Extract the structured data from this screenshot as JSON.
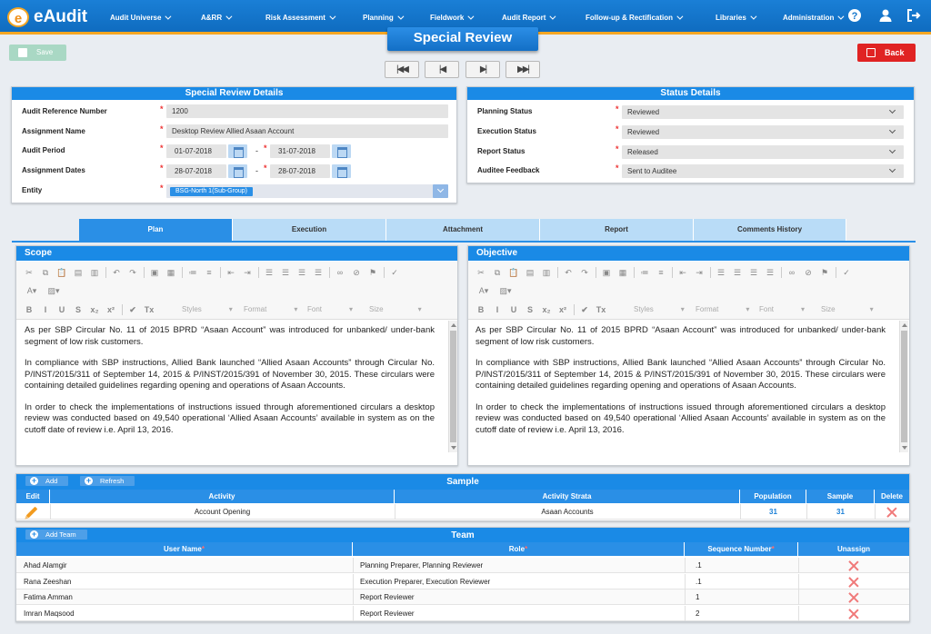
{
  "app": {
    "name": "eAudit",
    "logo_letter": "e"
  },
  "nav": {
    "items": [
      {
        "label": "Audit Universe"
      },
      {
        "label": "A&RR"
      },
      {
        "label": "Risk Assessment"
      },
      {
        "label": "Planning"
      },
      {
        "label": "Fieldwork"
      },
      {
        "label": "Audit Report"
      },
      {
        "label": "Follow-up & Rectification"
      },
      {
        "label": "Libraries"
      },
      {
        "label": "Administration"
      }
    ],
    "icons": [
      "help-icon",
      "user-icon",
      "logout-icon"
    ]
  },
  "page": {
    "title": "Special Review"
  },
  "toolbar": {
    "save_label": "Save",
    "back_label": "Back"
  },
  "pager": [
    "first-record-icon",
    "prev-record-icon",
    "next-record-icon",
    "last-record-icon"
  ],
  "details": {
    "title": "Special Review Details",
    "labels": {
      "ref": "Audit Reference Number",
      "assignment": "Assignment Name",
      "period": "Audit Period",
      "dates": "Assignment Dates",
      "entity": "Entity"
    },
    "values": {
      "ref": "1200",
      "assignment": "Desktop Review Allied Asaan Account",
      "period_from": "01-07-2018",
      "period_to": "31-07-2018",
      "dates_from": "28-07-2018",
      "dates_to": "28-07-2018",
      "entity": "BSG-North 1(Sub-Group)"
    },
    "dash": "-"
  },
  "status": {
    "title": "Status Details",
    "labels": {
      "planning": "Planning Status",
      "execution": "Execution Status",
      "report": "Report Status",
      "auditee": "Auditee Feedback"
    },
    "values": {
      "planning": "Reviewed",
      "execution": "Reviewed",
      "report": "Released",
      "auditee": "Sent to Auditee"
    }
  },
  "tabs": [
    {
      "label": "Plan",
      "active": true
    },
    {
      "label": "Execution"
    },
    {
      "label": "Attachment"
    },
    {
      "label": "Report"
    },
    {
      "label": "Comments History"
    }
  ],
  "editor_toolbar": {
    "styles": "Styles",
    "format": "Format",
    "font": "Font",
    "size": "Size"
  },
  "scope": {
    "title": "Scope",
    "paragraphs": [
      "As per SBP Circular No. 11 of 2015 BPRD “Asaan Account” was introduced for unbanked/ under-bank segment of low risk customers.",
      "In compliance with SBP instructions, Allied Bank launched “Allied Asaan Accounts” through Circular No. P/INST/2015/311 of September 14, 2015 & P/INST/2015/391 of November 30, 2015. These circulars were containing detailed guidelines regarding opening and operations of Asaan Accounts.",
      "In order to check the implementations of instructions issued through aforementioned circulars a desktop review was conducted based on 49,540 operational ‘Allied Asaan Accounts’ available in system as on the cutoff date of review i.e. April 13, 2016."
    ]
  },
  "objective": {
    "title": "Objective",
    "paragraphs": [
      "As per SBP Circular No. 11 of 2015 BPRD “Asaan Account” was introduced for unbanked/ under-bank segment of low risk customers.",
      "In compliance with SBP instructions, Allied Bank launched “Allied Asaan Accounts” through Circular No. P/INST/2015/311 of September 14, 2015 & P/INST/2015/391 of November 30, 2015. These circulars were containing detailed guidelines regarding opening and operations of Asaan Accounts.",
      "In order to check the implementations of instructions issued through aforementioned circulars a desktop review was conducted based on 49,540 operational ‘Allied Asaan Accounts’ available in system as on the cutoff date of review i.e. April 13, 2016."
    ]
  },
  "sample": {
    "title": "Sample",
    "add_label": "Add",
    "refresh_label": "Refresh",
    "headers": {
      "edit": "Edit",
      "activity": "Activity",
      "strata": "Activity Strata",
      "population": "Population",
      "sample": "Sample",
      "delete": "Delete"
    },
    "rows": [
      {
        "activity": "Account Opening",
        "strata": "Asaan Accounts",
        "population": "31",
        "sample": "31"
      }
    ]
  },
  "team": {
    "title": "Team",
    "add_label": "Add Team",
    "headers": {
      "user": "User Name",
      "role": "Role",
      "seq": "Sequence Number",
      "unassign": "Unassign"
    },
    "rows": [
      {
        "user": "Ahad Alamgir",
        "role": "Planning Preparer, Planning Reviewer",
        "seq": ".1"
      },
      {
        "user": "Rana Zeeshan",
        "role": "Execution Preparer, Execution Reviewer",
        "seq": ".1"
      },
      {
        "user": "Fatima Amman",
        "role": "Report Reviewer",
        "seq": "1"
      },
      {
        "user": "Imran Maqsood",
        "role": "Report Reviewer",
        "seq": "2"
      }
    ]
  },
  "colors": {
    "primary": "#1a8ae6",
    "accent": "#f5a623",
    "danger": "#e02323",
    "save": "#a9d8c4"
  }
}
